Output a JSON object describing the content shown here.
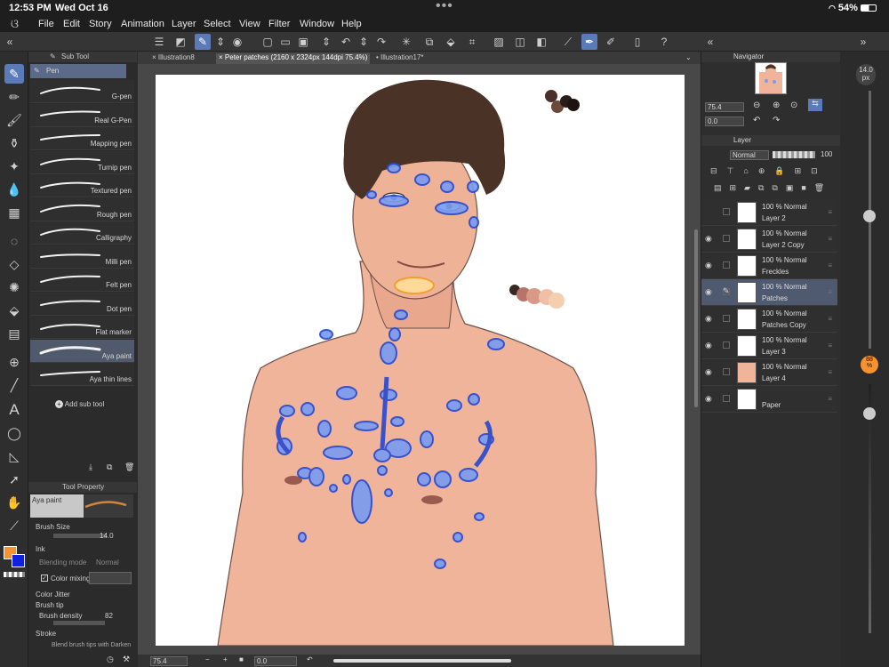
{
  "status_bar": {
    "time": "12:53 PM",
    "date": "Wed Oct 16",
    "battery": "54%"
  },
  "menu": [
    "File",
    "Edit",
    "Story",
    "Animation",
    "Layer",
    "Select",
    "View",
    "Filter",
    "Window",
    "Help"
  ],
  "doc_tabs": [
    {
      "label": "Illustration8"
    },
    {
      "label": "Peter patches (2160 x 2324px 144dpi 75.4%)"
    },
    {
      "label": "Illustration17*"
    }
  ],
  "subtool": {
    "panel_title": "Sub Tool",
    "group": "Pen",
    "items": [
      {
        "label": "G-pen"
      },
      {
        "label": "Real G-Pen"
      },
      {
        "label": "Mapping pen"
      },
      {
        "label": "Turnip pen"
      },
      {
        "label": "Textured pen"
      },
      {
        "label": "Rough pen"
      },
      {
        "label": "Calligraphy"
      },
      {
        "label": "Milli pen"
      },
      {
        "label": "Felt pen"
      },
      {
        "label": "Dot pen"
      },
      {
        "label": "Flat marker"
      },
      {
        "label": "Aya paint"
      },
      {
        "label": "Aya thin lines"
      }
    ],
    "add_sub_tool": "Add sub tool"
  },
  "tool_property": {
    "title": "Tool Property",
    "preset": "Aya paint",
    "brush_size_label": "Brush Size",
    "brush_size_value": "14.0",
    "ink_label": "Ink",
    "blending_mode_label": "Blending mode",
    "blending_mode_value": "Normal",
    "color_mixing_label": "Color mixing",
    "color_jitter_label": "Color Jitter",
    "brush_tip_label": "Brush tip",
    "brush_density_label": "Brush density",
    "brush_density_value": "82",
    "stroke_label": "Stroke",
    "blend_tips_label": "Blend brush tips with Darken"
  },
  "colors": {
    "main": "#f7922f",
    "sub": "#1020e0",
    "accent": "#5a7ab8"
  },
  "canvas_bottom": {
    "zoom": "75.4",
    "angle": "0.0"
  },
  "navigator": {
    "title": "Navigator",
    "zoom": "75.4",
    "angle": "0.0"
  },
  "layer_panel": {
    "title": "Layer",
    "blend_mode": "Normal",
    "opacity": "100",
    "layers": [
      {
        "mode": "100 % Normal",
        "name": "Layer 2",
        "visible": false,
        "selected": false
      },
      {
        "mode": "100 % Normal",
        "name": "Layer 2 Copy",
        "visible": true,
        "selected": false
      },
      {
        "mode": "100 % Normal",
        "name": "Freckles",
        "visible": true,
        "selected": false
      },
      {
        "mode": "100 % Normal",
        "name": "Patches",
        "visible": true,
        "selected": true
      },
      {
        "mode": "100 % Normal",
        "name": "Patches Copy",
        "visible": true,
        "selected": false
      },
      {
        "mode": "100 % Normal",
        "name": "Layer 3",
        "visible": true,
        "selected": false
      },
      {
        "mode": "100 % Normal",
        "name": "Layer 4",
        "visible": true,
        "selected": false
      },
      {
        "mode": "",
        "name": "Paper",
        "visible": true,
        "selected": false
      }
    ]
  },
  "right_sliders": {
    "brush_size": "14.0",
    "brush_size_unit": "px",
    "opacity_value": "88",
    "opacity_unit": "%"
  }
}
